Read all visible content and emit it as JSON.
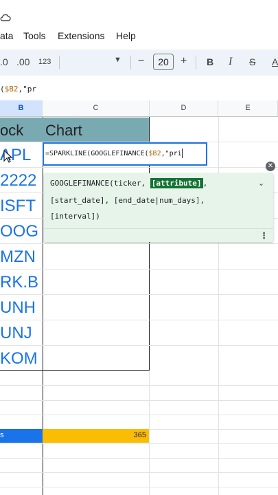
{
  "menu": {
    "items": [
      "ata",
      "Tools",
      "Extensions",
      "Help"
    ]
  },
  "toolbar": {
    "decrease_decimal": ".0",
    "increase_decimal": ".00",
    "number_format": "123",
    "font_size": "20",
    "minus": "−",
    "plus": "+",
    "bold": "B",
    "italic": "I",
    "strike": "S",
    "text_color": "A"
  },
  "formula_bar": {
    "prefix": "(",
    "ref": "$B2",
    "suffix": ",\"pr"
  },
  "columns": [
    "B",
    "C",
    "D",
    "E"
  ],
  "sheet": {
    "header_b": "ock",
    "header_c": "Chart",
    "stocks": [
      "APL",
      "2222",
      "ISFT",
      "OOG",
      "MZN",
      "RK.B",
      "UNH",
      "UNJ",
      "KOM"
    ],
    "bottom_label": "s",
    "bottom_value": "365"
  },
  "editor": {
    "equal": "=",
    "fn": "SPARKLINE(GOOGLEFINANCE(",
    "ref": "$B2",
    "tail": ",\"pri"
  },
  "tooltip": {
    "fn_name": "GOOGLEFINANCE(ticker, ",
    "highlight": "[attribute]",
    "comma": ",",
    "line2": "[start_date], [end_date|num_days],",
    "line3": "[interval])"
  },
  "colors": {
    "header_fill": "#7aaab1",
    "stock_text": "#1a73e8",
    "tooltip_bg": "#e6f4ea",
    "highlight": "#137333",
    "bottom_blue": "#1a73e8",
    "bottom_yellow": "#fbbc04"
  }
}
